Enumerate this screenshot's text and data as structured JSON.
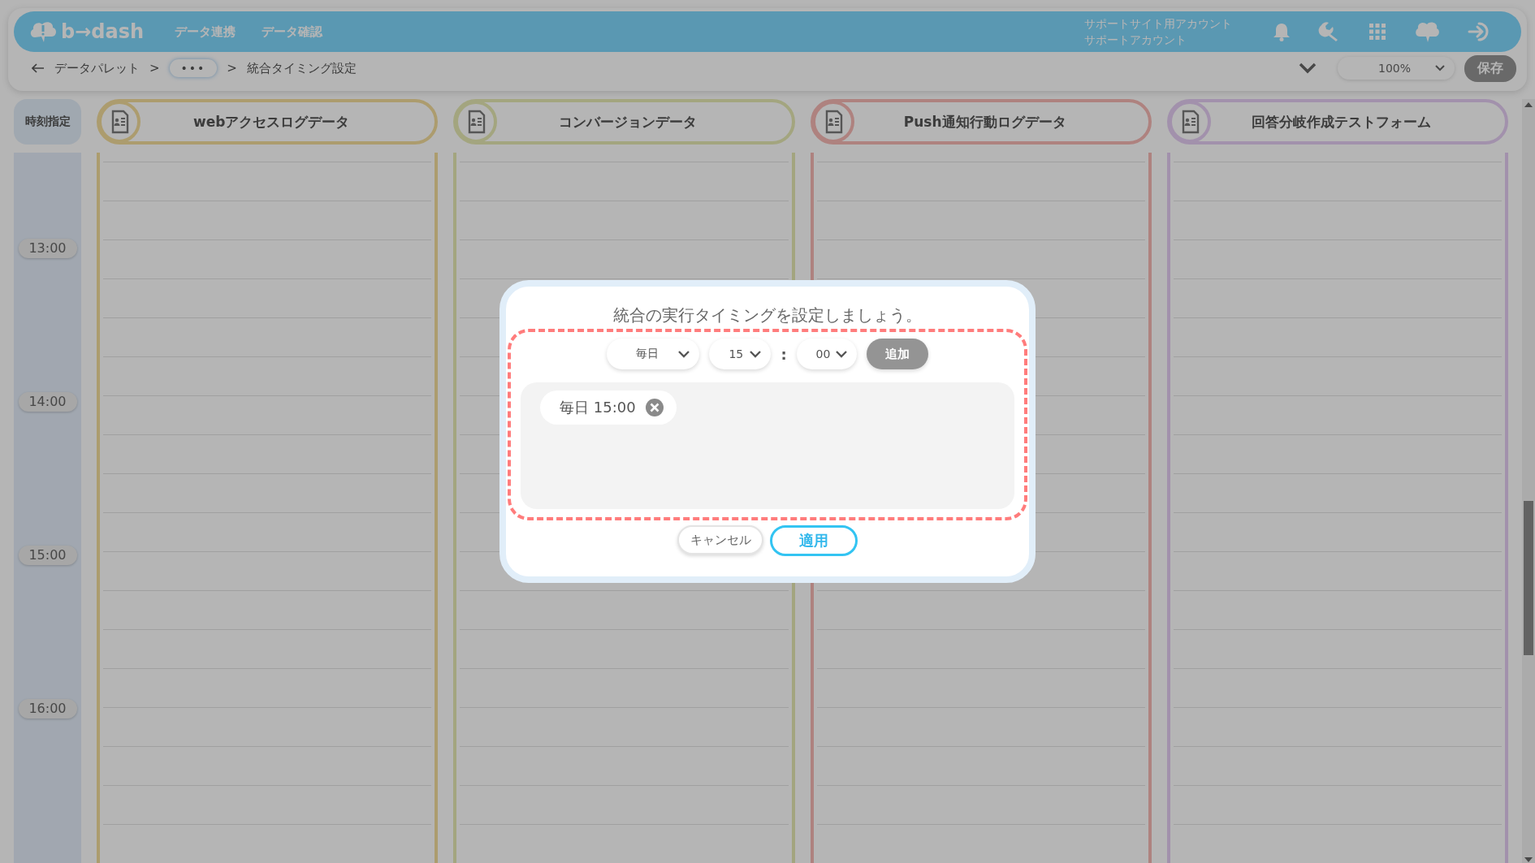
{
  "header": {
    "logo": "b→dash",
    "nav": [
      "データ連携",
      "データ確認"
    ],
    "account_site": "サポートサイト用アカウント",
    "account_name": "サポートアカウント"
  },
  "breadcrumb": {
    "separator": ">",
    "items": [
      {
        "kind": "link",
        "label": "データパレット"
      },
      {
        "kind": "more",
        "label": "•••"
      },
      {
        "kind": "current",
        "label": "統合タイミング設定"
      }
    ]
  },
  "toolbar": {
    "zoom": "100%",
    "save": {
      "label": "保存",
      "disabled": true
    }
  },
  "time_header": "時刻指定",
  "sources": [
    {
      "name": "webアクセスログデータ"
    },
    {
      "name": "コンバージョンデータ"
    },
    {
      "name": "Push通知行動ログデータ"
    },
    {
      "name": "回答分岐作成テストフォーム"
    }
  ],
  "time_labels": [
    "13:00",
    "14:00",
    "15:00",
    "16:00"
  ],
  "dialog": {
    "title": "統合の実行タイミングを設定しましょう。",
    "frequency": "毎日",
    "hour": "15",
    "separator": ":",
    "minute": "00",
    "add": {
      "label": "追加",
      "disabled": true
    },
    "schedules": [
      {
        "label": "毎日 15:00"
      }
    ],
    "cancel": "キャンセル",
    "apply": "適用"
  }
}
